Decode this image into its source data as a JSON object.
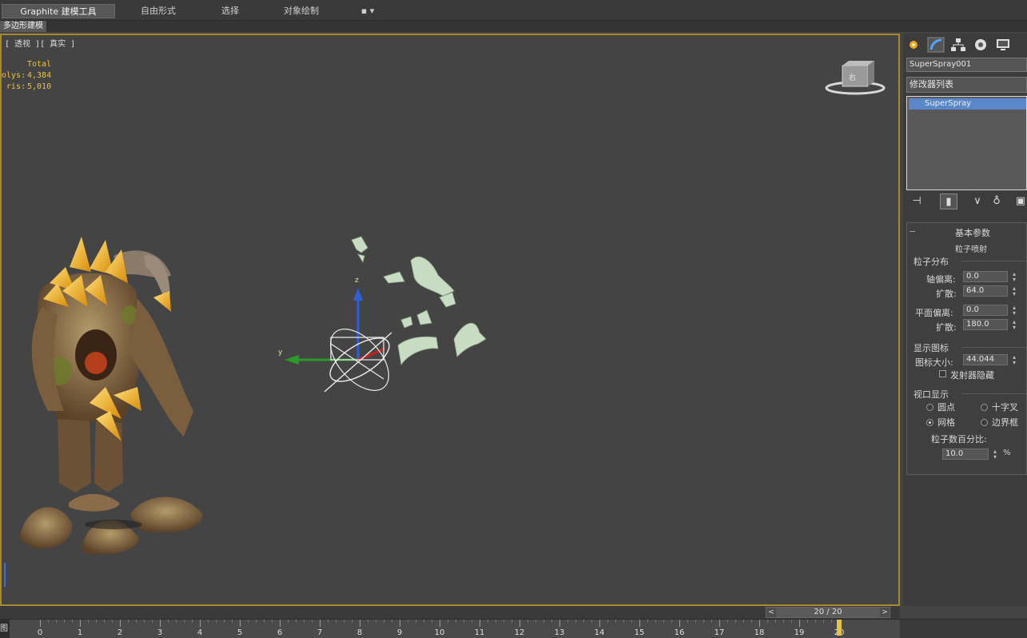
{
  "ribbon": {
    "tabs": [
      {
        "label": "Graphite 建模工具",
        "active": true
      },
      {
        "label": "自由形式",
        "active": false
      },
      {
        "label": "选择",
        "active": false
      },
      {
        "label": "对象绘制",
        "active": false
      },
      {
        "label": "▪ ▾",
        "active": false
      }
    ],
    "subtab": "多边形建模"
  },
  "viewport": {
    "label": "[ 透视 ][ 真实 ]",
    "stats": {
      "header": "Total",
      "rows": [
        {
          "key": "olys:",
          "value": "4,384"
        },
        {
          "key": "ris:",
          "value": "5,010"
        }
      ]
    },
    "viewcube_face": "右",
    "axis_y_label": "y",
    "axis_z_label": "z"
  },
  "command_panel": {
    "tab_icons": [
      "create-icon",
      "modify-icon",
      "hierarchy-icon",
      "motion-icon",
      "display-icon"
    ],
    "object_name": "SuperSpray001",
    "modifier_list": "修改器列表",
    "stack_item": "SuperSpray",
    "rollout": {
      "title": "基本参数",
      "subtitle": "粒子喷射",
      "group_dist": "粒子分布",
      "axis_offset_label": "轴偏离:",
      "axis_offset_value": "0.0",
      "spread1_label": "扩散:",
      "spread1_value": "64.0",
      "plane_offset_label": "平面偏离:",
      "plane_offset_value": "0.0",
      "spread2_label": "扩散:",
      "spread2_value": "180.0",
      "group_icon": "显示图标",
      "icon_size_label": "图标大小:",
      "icon_size_value": "44.044",
      "emitter_hidden_label": "发射器隐藏",
      "group_viewport": "视口显示",
      "radio_dots": "圆点",
      "radio_ticks": "十字叉",
      "radio_mesh": "网格",
      "radio_bbox": "边界框",
      "percent_label": "粒子数百分比:",
      "percent_value": "10.0",
      "percent_unit": "%"
    }
  },
  "timeline": {
    "readout": "20 / 20",
    "current_frame": 20,
    "total_frames": 20,
    "ticks": [
      "0",
      "1",
      "2",
      "3",
      "4",
      "5",
      "6",
      "7",
      "8",
      "9",
      "10",
      "11",
      "12",
      "13",
      "14",
      "15",
      "16",
      "17",
      "18",
      "19",
      "20"
    ],
    "left_label": "图"
  },
  "colors": {
    "viewport_border": "#a88a2a",
    "selection_blue": "#5a87c9",
    "stats_yellow": "#e8c34a",
    "particle_color": "#c8dcc4"
  }
}
